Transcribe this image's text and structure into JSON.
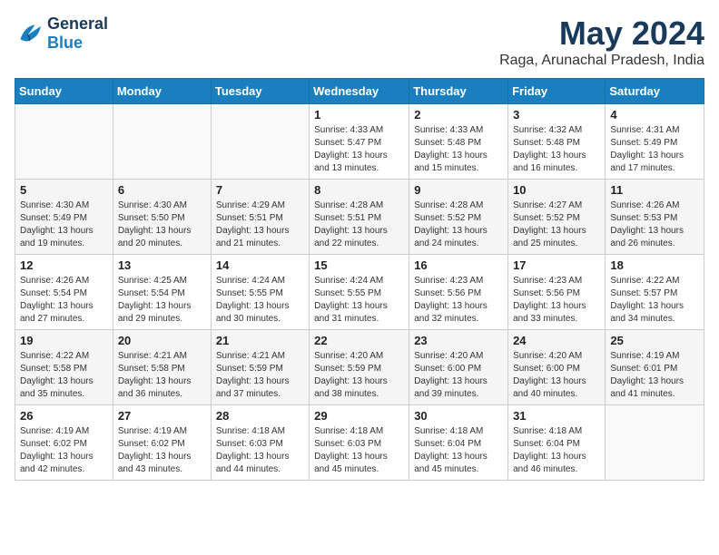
{
  "header": {
    "logo_line1": "General",
    "logo_line2": "Blue",
    "month": "May 2024",
    "location": "Raga, Arunachal Pradesh, India"
  },
  "weekdays": [
    "Sunday",
    "Monday",
    "Tuesday",
    "Wednesday",
    "Thursday",
    "Friday",
    "Saturday"
  ],
  "weeks": [
    [
      {
        "day": "",
        "info": ""
      },
      {
        "day": "",
        "info": ""
      },
      {
        "day": "",
        "info": ""
      },
      {
        "day": "1",
        "info": "Sunrise: 4:33 AM\nSunset: 5:47 PM\nDaylight: 13 hours\nand 13 minutes."
      },
      {
        "day": "2",
        "info": "Sunrise: 4:33 AM\nSunset: 5:48 PM\nDaylight: 13 hours\nand 15 minutes."
      },
      {
        "day": "3",
        "info": "Sunrise: 4:32 AM\nSunset: 5:48 PM\nDaylight: 13 hours\nand 16 minutes."
      },
      {
        "day": "4",
        "info": "Sunrise: 4:31 AM\nSunset: 5:49 PM\nDaylight: 13 hours\nand 17 minutes."
      }
    ],
    [
      {
        "day": "5",
        "info": "Sunrise: 4:30 AM\nSunset: 5:49 PM\nDaylight: 13 hours\nand 19 minutes."
      },
      {
        "day": "6",
        "info": "Sunrise: 4:30 AM\nSunset: 5:50 PM\nDaylight: 13 hours\nand 20 minutes."
      },
      {
        "day": "7",
        "info": "Sunrise: 4:29 AM\nSunset: 5:51 PM\nDaylight: 13 hours\nand 21 minutes."
      },
      {
        "day": "8",
        "info": "Sunrise: 4:28 AM\nSunset: 5:51 PM\nDaylight: 13 hours\nand 22 minutes."
      },
      {
        "day": "9",
        "info": "Sunrise: 4:28 AM\nSunset: 5:52 PM\nDaylight: 13 hours\nand 24 minutes."
      },
      {
        "day": "10",
        "info": "Sunrise: 4:27 AM\nSunset: 5:52 PM\nDaylight: 13 hours\nand 25 minutes."
      },
      {
        "day": "11",
        "info": "Sunrise: 4:26 AM\nSunset: 5:53 PM\nDaylight: 13 hours\nand 26 minutes."
      }
    ],
    [
      {
        "day": "12",
        "info": "Sunrise: 4:26 AM\nSunset: 5:54 PM\nDaylight: 13 hours\nand 27 minutes."
      },
      {
        "day": "13",
        "info": "Sunrise: 4:25 AM\nSunset: 5:54 PM\nDaylight: 13 hours\nand 29 minutes."
      },
      {
        "day": "14",
        "info": "Sunrise: 4:24 AM\nSunset: 5:55 PM\nDaylight: 13 hours\nand 30 minutes."
      },
      {
        "day": "15",
        "info": "Sunrise: 4:24 AM\nSunset: 5:55 PM\nDaylight: 13 hours\nand 31 minutes."
      },
      {
        "day": "16",
        "info": "Sunrise: 4:23 AM\nSunset: 5:56 PM\nDaylight: 13 hours\nand 32 minutes."
      },
      {
        "day": "17",
        "info": "Sunrise: 4:23 AM\nSunset: 5:56 PM\nDaylight: 13 hours\nand 33 minutes."
      },
      {
        "day": "18",
        "info": "Sunrise: 4:22 AM\nSunset: 5:57 PM\nDaylight: 13 hours\nand 34 minutes."
      }
    ],
    [
      {
        "day": "19",
        "info": "Sunrise: 4:22 AM\nSunset: 5:58 PM\nDaylight: 13 hours\nand 35 minutes."
      },
      {
        "day": "20",
        "info": "Sunrise: 4:21 AM\nSunset: 5:58 PM\nDaylight: 13 hours\nand 36 minutes."
      },
      {
        "day": "21",
        "info": "Sunrise: 4:21 AM\nSunset: 5:59 PM\nDaylight: 13 hours\nand 37 minutes."
      },
      {
        "day": "22",
        "info": "Sunrise: 4:20 AM\nSunset: 5:59 PM\nDaylight: 13 hours\nand 38 minutes."
      },
      {
        "day": "23",
        "info": "Sunrise: 4:20 AM\nSunset: 6:00 PM\nDaylight: 13 hours\nand 39 minutes."
      },
      {
        "day": "24",
        "info": "Sunrise: 4:20 AM\nSunset: 6:00 PM\nDaylight: 13 hours\nand 40 minutes."
      },
      {
        "day": "25",
        "info": "Sunrise: 4:19 AM\nSunset: 6:01 PM\nDaylight: 13 hours\nand 41 minutes."
      }
    ],
    [
      {
        "day": "26",
        "info": "Sunrise: 4:19 AM\nSunset: 6:02 PM\nDaylight: 13 hours\nand 42 minutes."
      },
      {
        "day": "27",
        "info": "Sunrise: 4:19 AM\nSunset: 6:02 PM\nDaylight: 13 hours\nand 43 minutes."
      },
      {
        "day": "28",
        "info": "Sunrise: 4:18 AM\nSunset: 6:03 PM\nDaylight: 13 hours\nand 44 minutes."
      },
      {
        "day": "29",
        "info": "Sunrise: 4:18 AM\nSunset: 6:03 PM\nDaylight: 13 hours\nand 45 minutes."
      },
      {
        "day": "30",
        "info": "Sunrise: 4:18 AM\nSunset: 6:04 PM\nDaylight: 13 hours\nand 45 minutes."
      },
      {
        "day": "31",
        "info": "Sunrise: 4:18 AM\nSunset: 6:04 PM\nDaylight: 13 hours\nand 46 minutes."
      },
      {
        "day": "",
        "info": ""
      }
    ]
  ]
}
